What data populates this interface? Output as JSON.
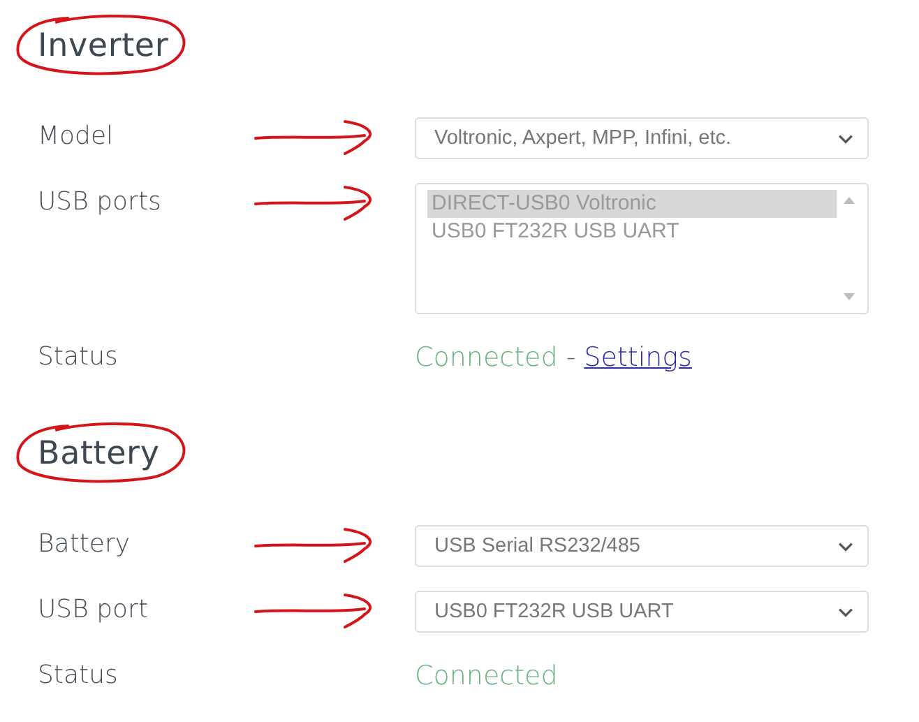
{
  "sections": [
    {
      "heading": "Inverter",
      "circled": true,
      "rows": [
        {
          "kind": "select",
          "label": "Model",
          "arrow": true,
          "value": "Voltronic, Axpert, MPP, Infini, etc."
        },
        {
          "kind": "listbox",
          "label": "USB ports",
          "arrow": true,
          "disabled": true,
          "options": [
            {
              "text": "DIRECT-USB0 Voltronic",
              "selected": true
            },
            {
              "text": "USB0 FT232R USB UART",
              "selected": false
            }
          ]
        },
        {
          "kind": "status",
          "label": "Status",
          "ok": true,
          "value": "Connected",
          "separator": "-",
          "link": "Settings"
        }
      ]
    },
    {
      "heading": "Battery",
      "circled": true,
      "rows": [
        {
          "kind": "select",
          "label": "Battery",
          "arrow": true,
          "value": "USB Serial RS232/485"
        },
        {
          "kind": "select",
          "label": "USB port",
          "arrow": true,
          "value": "USB0 FT232R USB UART"
        },
        {
          "kind": "status",
          "label": "Status",
          "ok": true,
          "value": "Connected"
        }
      ]
    }
  ]
}
